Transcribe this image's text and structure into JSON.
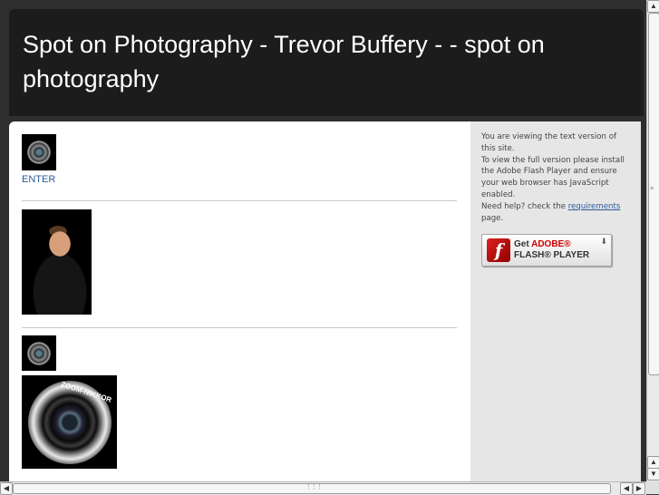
{
  "header": {
    "title": "Spot on Photography - Trevor Buffery - - spot on photography"
  },
  "content": {
    "enter_label": "ENTER",
    "lens_label": "ZOOM-NIKKOR"
  },
  "sidebar": {
    "notice_line1": "You are viewing the text version of this site.",
    "notice_line2": "To view the full version please install the Adobe Flash Player and ensure your web browser has JavaScript enabled.",
    "help_prefix": "Need help? check the ",
    "requirements_link": "requirements",
    "help_suffix": " page.",
    "flash_get": "Get",
    "flash_adobe": "ADOBE®",
    "flash_player": "FLASH® PLAYER",
    "flash_logo_glyph": "f"
  },
  "colors": {
    "header_bg": "#1c1c1c",
    "sidebar_bg": "#e6e6e6",
    "link": "#2a5a9a",
    "adobe_red": "#cc0000"
  }
}
